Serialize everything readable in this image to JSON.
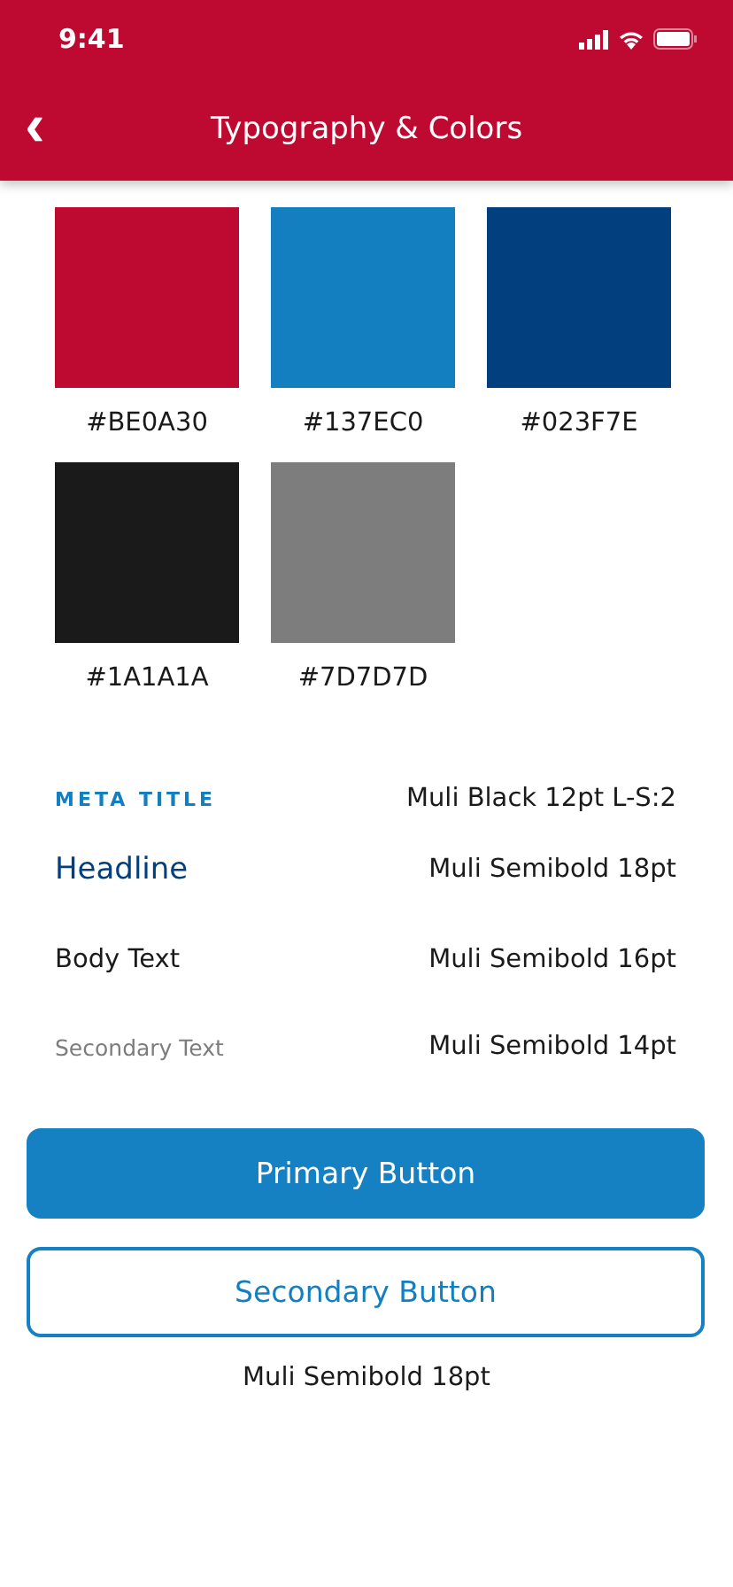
{
  "status_bar": {
    "time": "9:41"
  },
  "header": {
    "back_icon": "‹",
    "title": "Typography & Colors"
  },
  "swatches": [
    {
      "label": "#BE0A30",
      "color": "#be0a30"
    },
    {
      "label": "#137EC0",
      "color": "#137ec0"
    },
    {
      "label": "#023F7E",
      "color": "#023f7e"
    },
    {
      "label": "#1A1A1A",
      "color": "#1a1a1a"
    },
    {
      "label": "#7D7D7D",
      "color": "#7d7d7d"
    }
  ],
  "type_samples": [
    {
      "kind": "meta",
      "sample": "META TITLE",
      "spec": "Muli Black 12pt L-S:2"
    },
    {
      "kind": "headline",
      "sample": "Headline",
      "spec": "Muli Semibold 18pt"
    },
    {
      "kind": "body",
      "sample": "Body Text",
      "spec": "Muli Semibold 16pt"
    },
    {
      "kind": "secondary",
      "sample": "Secondary Text",
      "spec": "Muli Semibold 14pt"
    }
  ],
  "buttons": [
    {
      "kind": "primary",
      "label": "Primary Button"
    },
    {
      "kind": "secondary",
      "label": "Secondary Button"
    }
  ],
  "button_caption": "Muli Semibold 18pt"
}
